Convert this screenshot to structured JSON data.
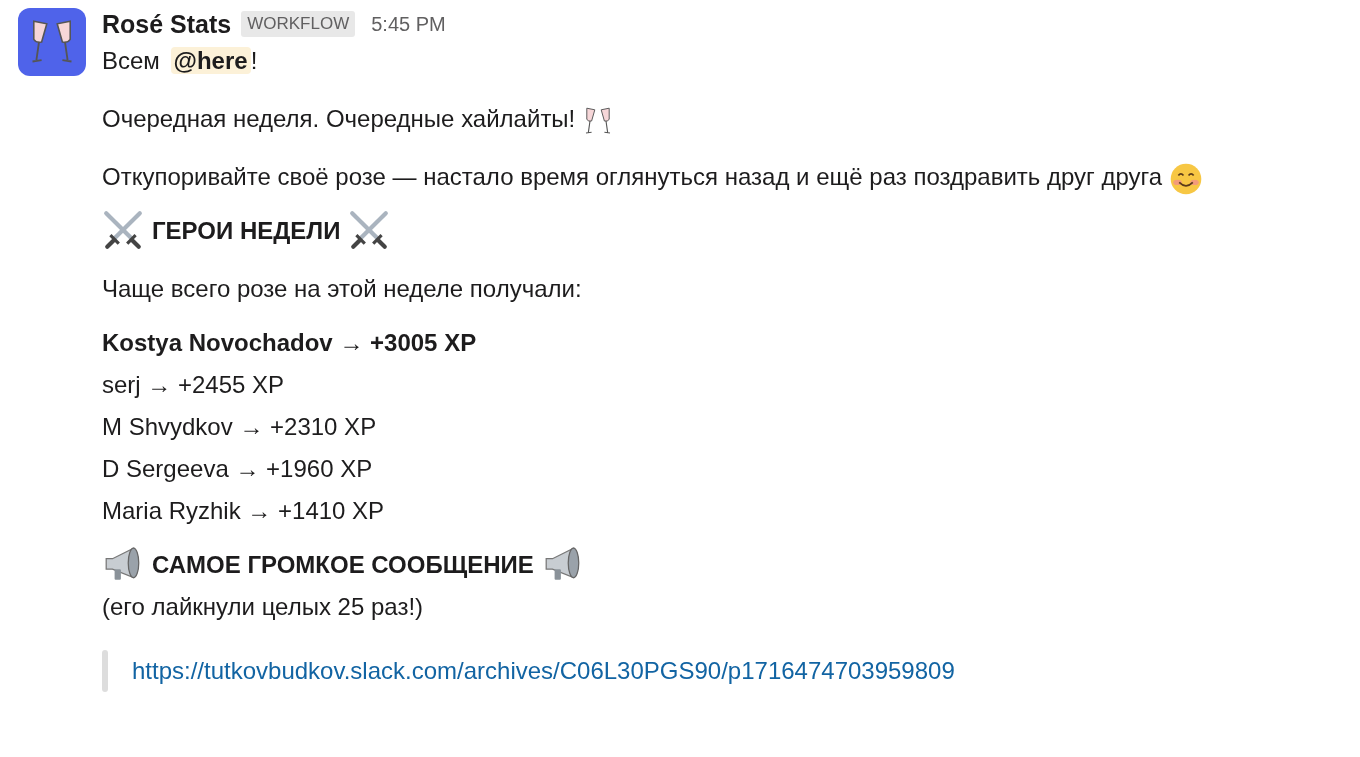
{
  "message": {
    "sender": "Rosé Stats",
    "badge": "WORKFLOW",
    "time": "5:45 PM",
    "greeting": {
      "before": "Всем",
      "mention": "@here",
      "after": "!"
    },
    "intro": "Очередная неделя. Очередные хайлайты!",
    "invite": "Откупоривайте своё розе — настало время оглянуться назад и ещё раз поздравить друг друга",
    "heroes_heading": "ГЕРОИ НЕДЕЛИ",
    "heroes_intro": "Чаще всего розе на этой неделе получали:",
    "leaders": [
      {
        "text": "Kostya Novochadov → +3005 XP",
        "emphasized": true
      },
      {
        "text": "serj → +2455 XP",
        "emphasized": false
      },
      {
        "text": "M Shvydkov → +2310 XP",
        "emphasized": false
      },
      {
        "text": "D Sergeeva → +1960 XP",
        "emphasized": false
      },
      {
        "text": "Maria Ryzhik → +1410 XP",
        "emphasized": false
      }
    ],
    "loudest_heading": "САМОЕ ГРОМКОЕ СООБЩЕНИЕ",
    "loudest_note": "(его лайкнули целых 25 раз!)",
    "link": "https://tutkovbudkov.slack.com/archives/C06L30PGS90/p1716474703959809"
  }
}
